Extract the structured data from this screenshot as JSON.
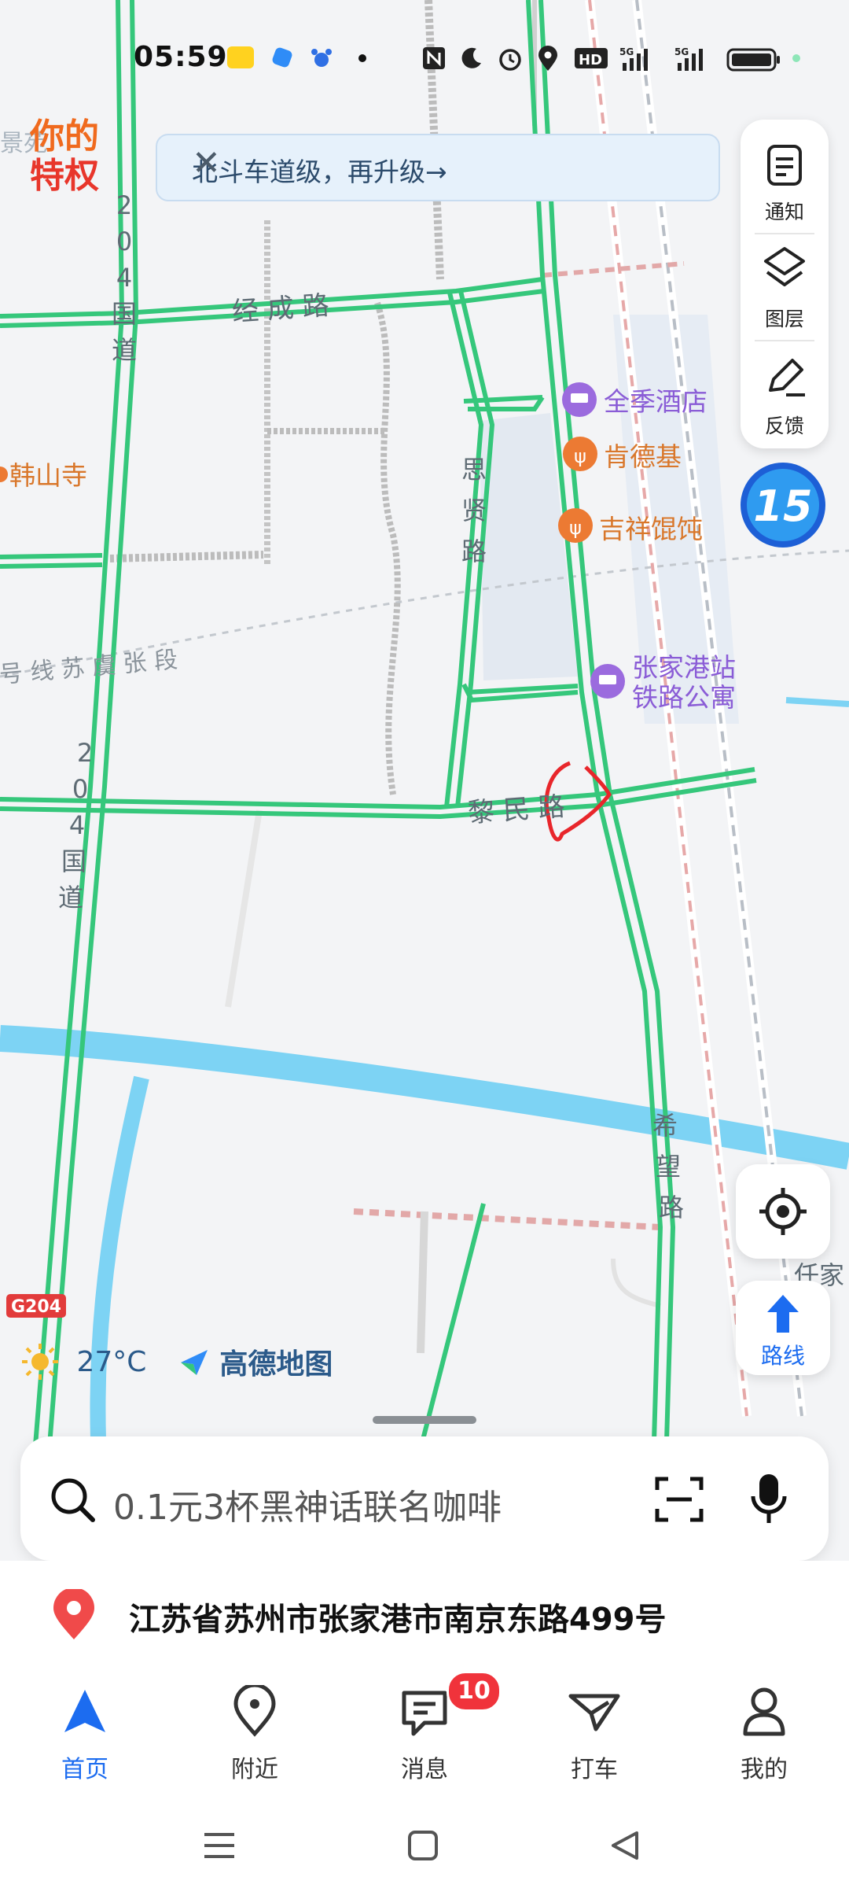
{
  "status_bar": {
    "time": "05:59"
  },
  "banner": {
    "text": "北斗车道级，再升级→",
    "close_label": "✕"
  },
  "promo": {
    "line1": "你的",
    "line2": "特权",
    "edge": "景苑"
  },
  "side_panel": {
    "items": [
      {
        "label": "通知",
        "icon": "notification-icon"
      },
      {
        "label": "图层",
        "icon": "layers-icon"
      },
      {
        "label": "反馈",
        "icon": "feedback-pencil-icon"
      }
    ],
    "badge_label": "15"
  },
  "map": {
    "road_labels": {
      "g204_upper": [
        "2",
        "0",
        "4",
        "国",
        "道"
      ],
      "g204_lower": [
        "2",
        "0",
        "4",
        "国",
        "道"
      ],
      "jingcheng": "经 成 路",
      "sixian": [
        "思",
        "贤",
        "路"
      ],
      "limin": "黎 民 路",
      "xiwang": [
        "希",
        "望",
        "路"
      ],
      "railway": "号 线 苏 虞 张 段",
      "renjia": "任家",
      "g204_shield": "G204"
    },
    "pois": [
      {
        "name": "全季酒店",
        "kind": "hotel"
      },
      {
        "name": "肯德基",
        "kind": "restaurant"
      },
      {
        "name": "吉祥馄饨",
        "kind": "restaurant"
      },
      {
        "name_line1": "张家港站",
        "name_line2": "铁路公寓",
        "kind": "hotel"
      },
      {
        "name": "韩山寺",
        "kind": "place"
      }
    ]
  },
  "weather": {
    "temp": "27°C",
    "brand": "高德地图"
  },
  "search": {
    "placeholder": "0.1元3杯黑神话联名咖啡"
  },
  "location": {
    "address": "江苏省苏州市张家港市南京东路499号"
  },
  "route_button": {
    "label": "路线"
  },
  "tabs": [
    {
      "label": "首页",
      "active": true,
      "icon": "home-nav-icon"
    },
    {
      "label": "附近",
      "active": false,
      "icon": "nearby-pin-icon"
    },
    {
      "label": "消息",
      "active": false,
      "icon": "message-icon"
    },
    {
      "label": "打车",
      "active": false,
      "icon": "taxi-icon"
    },
    {
      "label": "我的",
      "active": false,
      "icon": "profile-icon"
    }
  ],
  "message_badge": "10",
  "colors": {
    "accent": "#1c6cf0",
    "road": "#35c77b",
    "water": "#7dd3f4",
    "badge": "#f0333b"
  }
}
